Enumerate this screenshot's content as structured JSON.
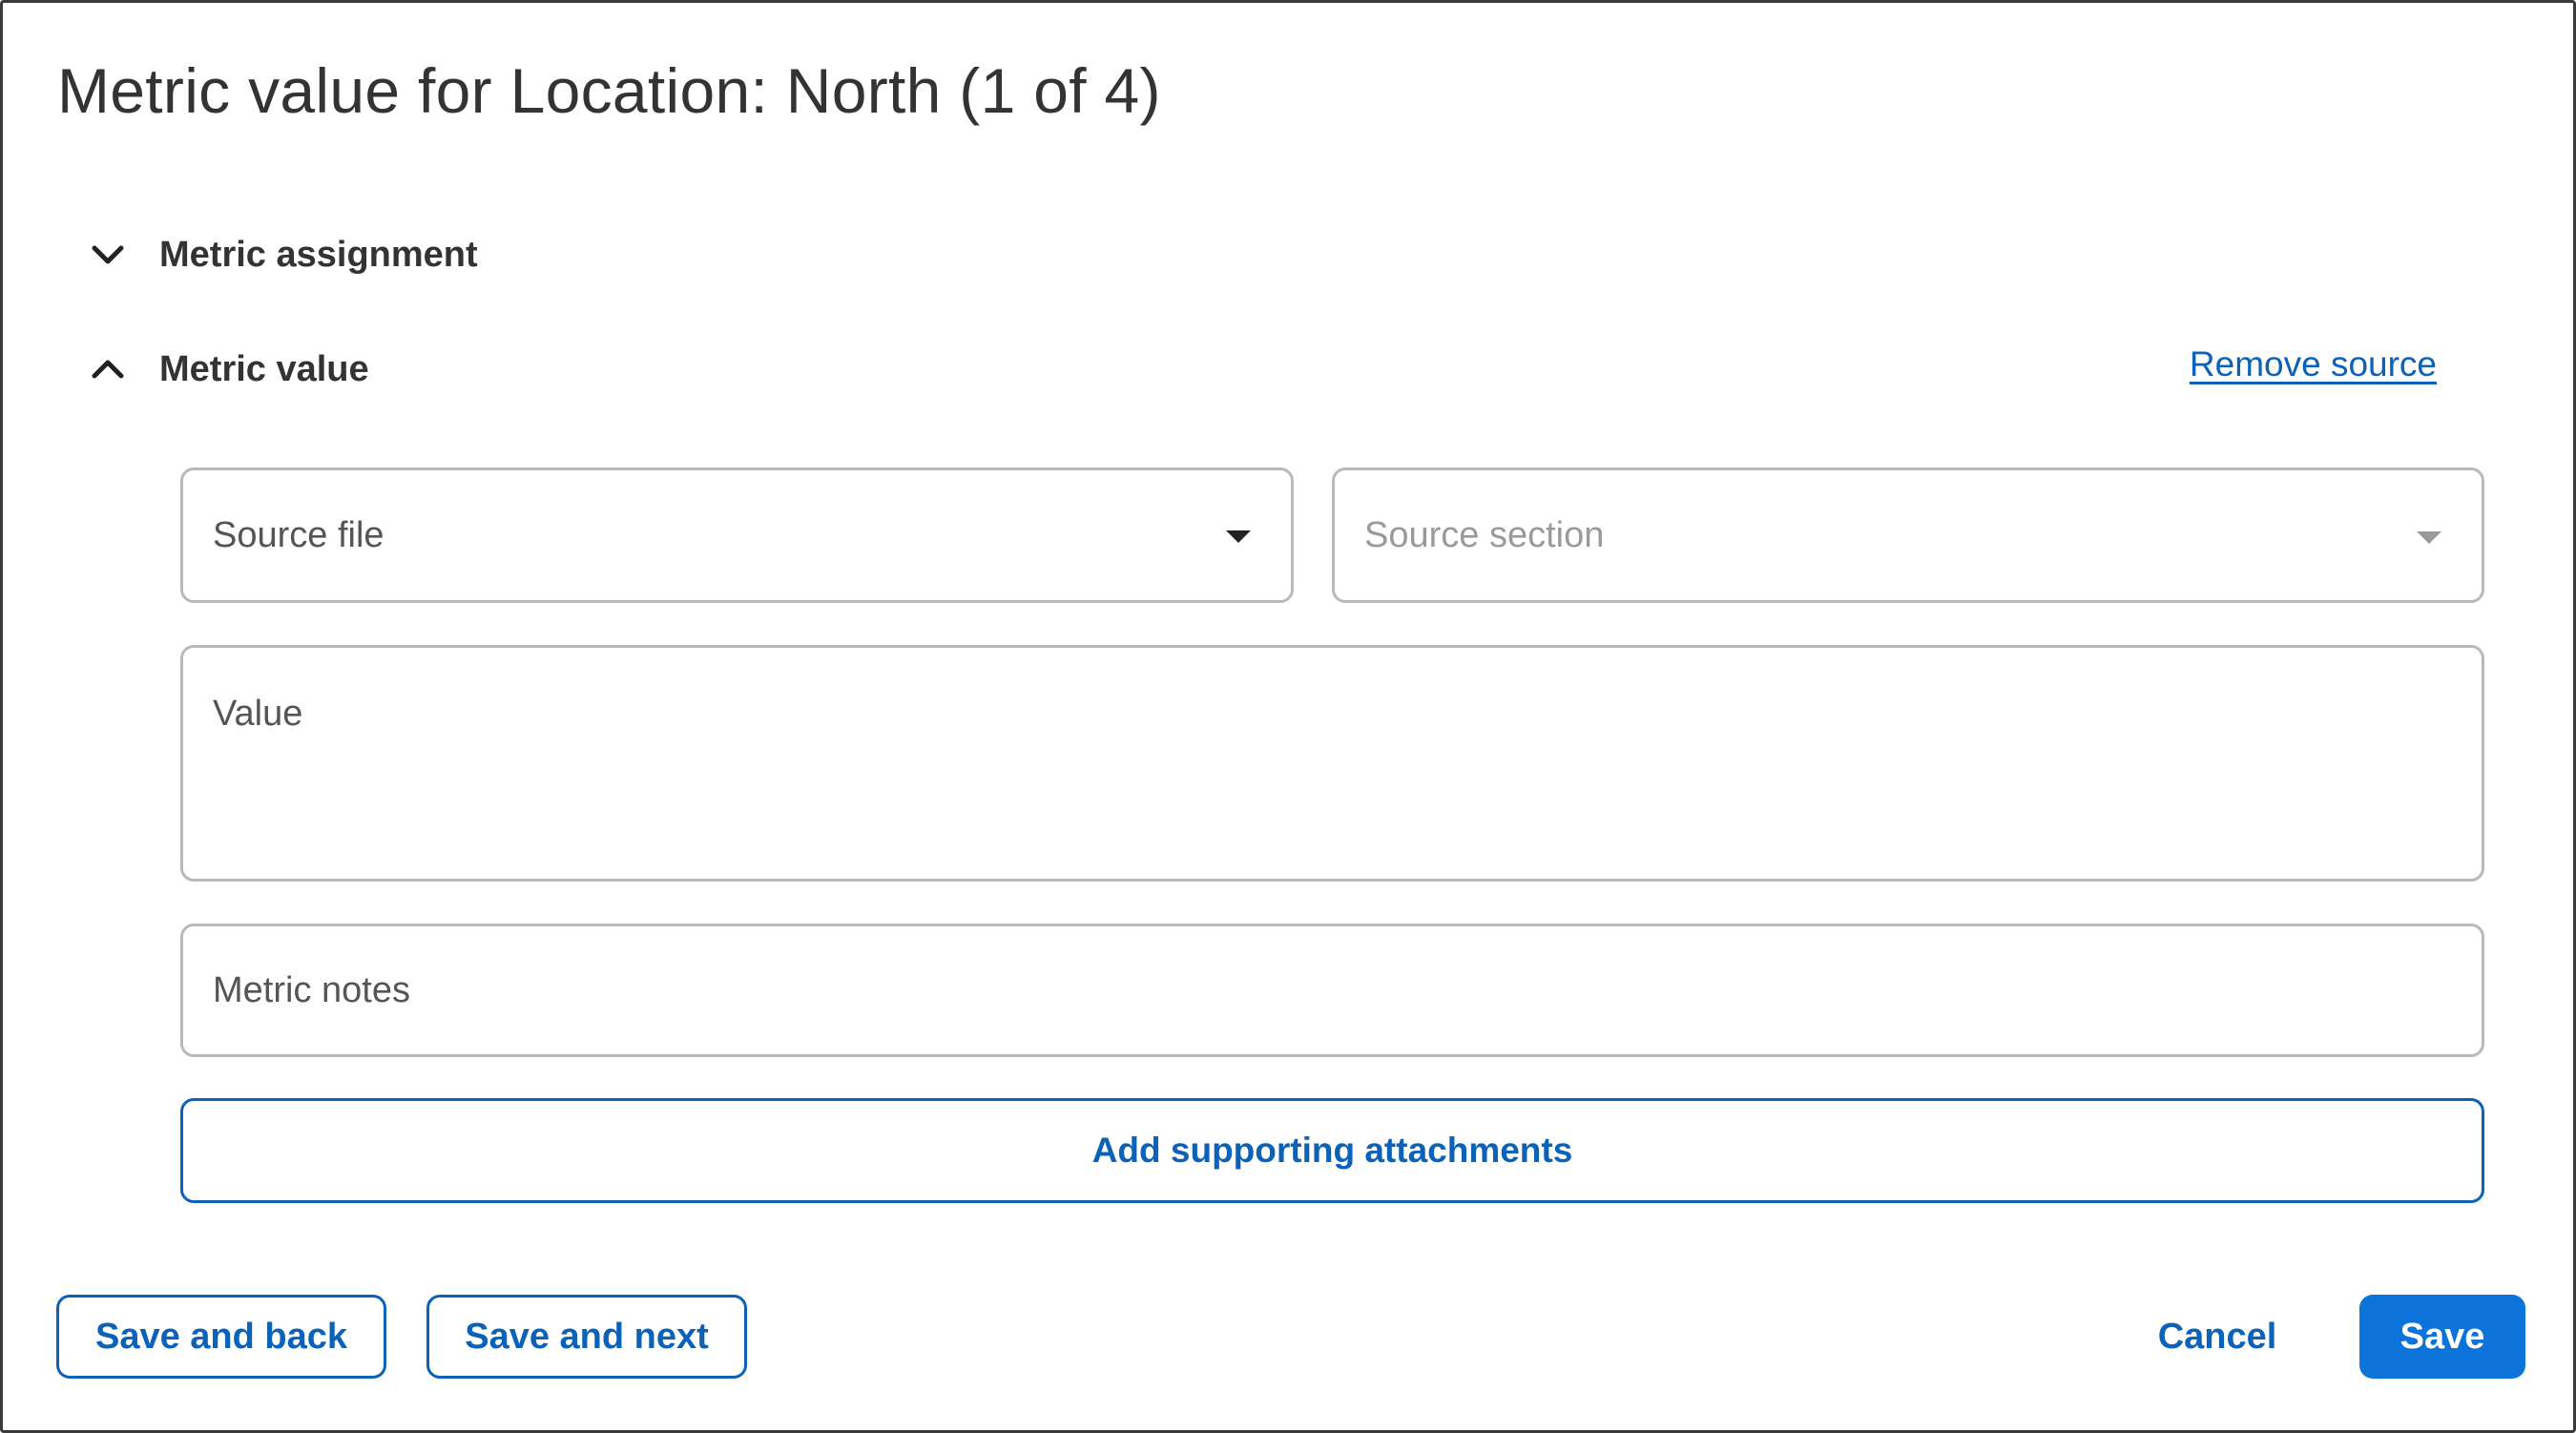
{
  "dialog": {
    "title": "Metric value for Location: North (1 of 4)"
  },
  "sections": {
    "assignment": {
      "label": "Metric assignment",
      "expanded": false,
      "icon": "chevron-down-icon"
    },
    "value": {
      "label": "Metric value",
      "expanded": true,
      "icon": "chevron-up-icon"
    }
  },
  "remove_source_label": "Remove source",
  "fields": {
    "source_file": {
      "placeholder": "Source file",
      "value": ""
    },
    "source_section": {
      "placeholder": "Source section",
      "value": "",
      "disabled": true
    },
    "value": {
      "placeholder": "Value",
      "value": ""
    },
    "metric_notes": {
      "placeholder": "Metric notes",
      "value": ""
    }
  },
  "attach_label": "Add supporting attachments",
  "footer": {
    "save_and_back": "Save and back",
    "save_and_next": "Save and next",
    "cancel": "Cancel",
    "save": "Save"
  },
  "colors": {
    "accent": "#0b62b8",
    "primary_button": "#0b73d9",
    "text": "#333333",
    "border": "#b9b9b9"
  }
}
